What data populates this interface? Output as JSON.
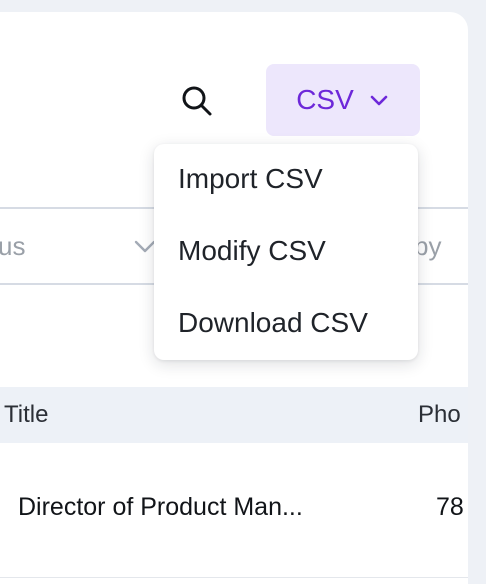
{
  "toolbar": {
    "search_icon": "search-icon",
    "csv_label": "CSV",
    "csv_chevron_icon": "chevron-down-icon"
  },
  "filters": {
    "status_partial": "us",
    "right_partial": "by"
  },
  "csv_menu": {
    "items": [
      {
        "label": "Import CSV"
      },
      {
        "label": "Modify CSV"
      },
      {
        "label": "Download CSV"
      }
    ]
  },
  "table": {
    "columns": [
      "Title",
      "Pho"
    ],
    "rows": [
      {
        "title": "Director of Product Man...",
        "phone": "78"
      }
    ]
  },
  "colors": {
    "accent": "#6d28d9",
    "accent_bg": "#ede7fc",
    "header_bg": "#edf1f7"
  }
}
